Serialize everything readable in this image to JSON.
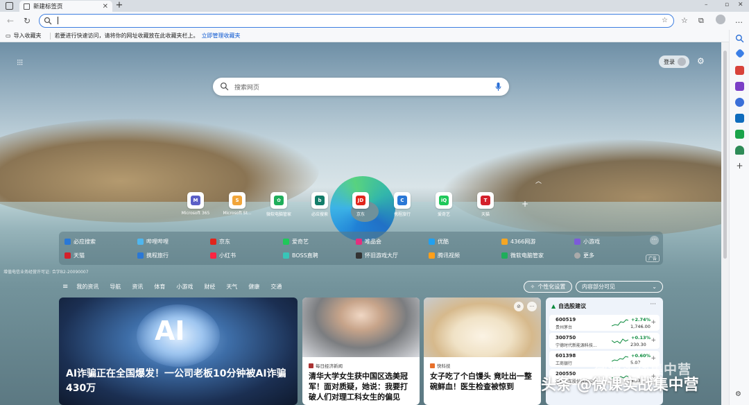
{
  "browser": {
    "tab_title": "新建标签页",
    "new_tab": "+",
    "window_controls": [
      "–",
      "▫",
      "✕"
    ]
  },
  "address_bar": {
    "value": ""
  },
  "favorites_bar": {
    "import_label": "导入收藏夹",
    "hint": "若要进行快速访问，请将你的网址收藏放在此收藏夹栏上。",
    "manage_link": "立即管理收藏夹"
  },
  "header": {
    "login_label": "登录"
  },
  "search": {
    "placeholder": "搜索网页"
  },
  "quick_links": [
    {
      "label": "Microsoft 365",
      "color": "#5b5fc7",
      "mark": "M"
    },
    {
      "label": "Microsoft St...",
      "color": "#f1a53a",
      "mark": "S"
    },
    {
      "label": "微软电脑管家",
      "color": "#1fae5b",
      "mark": "✿"
    },
    {
      "label": "必应搜索",
      "color": "#137d6a",
      "mark": "b"
    },
    {
      "label": "京东",
      "color": "#e1251b",
      "mark": "JD"
    },
    {
      "label": "携程旅行",
      "color": "#2a78d6",
      "mark": "C"
    },
    {
      "label": "爱奇艺",
      "color": "#1fc85a",
      "mark": "iQ"
    },
    {
      "label": "天猫",
      "color": "#d4202b",
      "mark": "T"
    }
  ],
  "services": [
    {
      "label": "必应搜索",
      "color": "#2a78d6"
    },
    {
      "label": "哔哩哔哩",
      "color": "#4fb6ee"
    },
    {
      "label": "京东",
      "color": "#e1251b"
    },
    {
      "label": "爱奇艺",
      "color": "#1fc85a"
    },
    {
      "label": "唯品会",
      "color": "#e3307e"
    },
    {
      "label": "优酷",
      "color": "#21a0f0"
    },
    {
      "label": "4366网游",
      "color": "#f5a623"
    },
    {
      "label": "小游戏",
      "color": "#7c5bd9"
    },
    {
      "label": "天猫",
      "color": "#d4202b"
    },
    {
      "label": "携程旅行",
      "color": "#2a78d6"
    },
    {
      "label": "小红书",
      "color": "#ff2442"
    },
    {
      "label": "BOSS直聘",
      "color": "#38c5b8"
    },
    {
      "label": "怀旧游戏大厅",
      "color": "#333333"
    },
    {
      "label": "腾讯视频",
      "color": "#ff9f1a"
    },
    {
      "label": "微软电脑管家",
      "color": "#1fae5b"
    },
    {
      "label": "更多",
      "color": "#aaaaaa"
    }
  ],
  "ad_label": "广告",
  "icp_text": "增值电信业务经营许可证: 合字B2-20090007",
  "news_nav": {
    "items": [
      "我的资讯",
      "导航",
      "资讯",
      "体育",
      "小游戏",
      "财经",
      "天气",
      "健康",
      "交通"
    ],
    "personalize": "个性化设置",
    "visibility": "内容部分可见"
  },
  "cards": {
    "main": {
      "image_text": "AI",
      "title": "AI诈骗正在全国爆发！一公司老板10分钟被AI诈骗430万"
    },
    "card1": {
      "source": "每日经济新闻",
      "title": "清华大学女生获中国区选美冠军！面对质疑，她说：我要打破人们对理工科女生的偏见"
    },
    "card2": {
      "source": "快科技",
      "title": "女子吃了个白馒头 竟吐出一整碗鲜血！医生检查被惊到"
    }
  },
  "stocks": {
    "title": "自选股建议",
    "rows": [
      {
        "code": "600519",
        "name": "贵州茅台",
        "change": "+2.74%",
        "price": "1,746.00"
      },
      {
        "code": "300750",
        "name": "宁德时代新能源科技...",
        "change": "+0.13%",
        "price": "230.30"
      },
      {
        "code": "601398",
        "name": "工商银行",
        "change": "+0.60%",
        "price": "5.07"
      },
      {
        "code": "200550",
        "name": "江铃汽车股份有限公司",
        "change": "",
        "price": "6.53"
      }
    ]
  },
  "watermark": {
    "top": "微课实战集中营",
    "bottom": "头条 @微课实战集中营"
  }
}
